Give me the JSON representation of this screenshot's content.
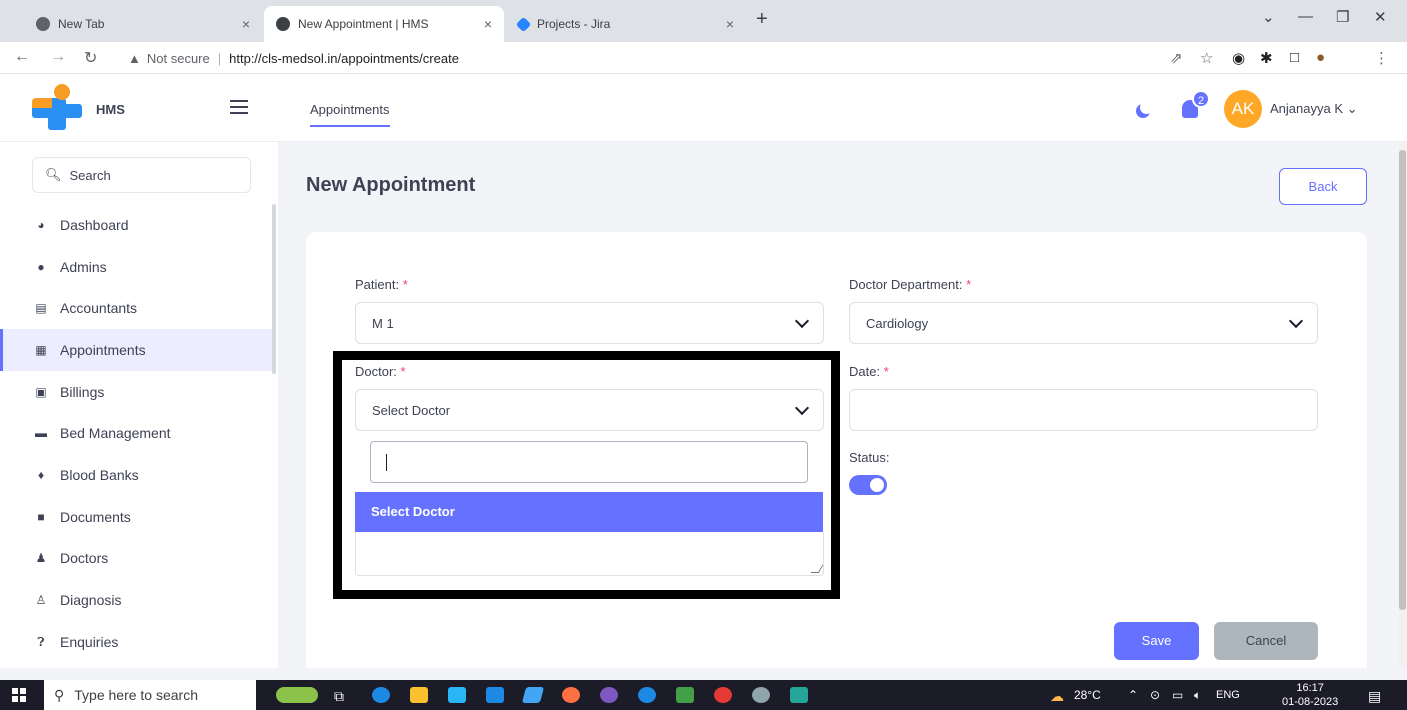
{
  "browser": {
    "tabs": [
      {
        "title": "New Tab",
        "active": false
      },
      {
        "title": "New Appointment | HMS",
        "active": true
      },
      {
        "title": "Projects - Jira",
        "active": false
      }
    ],
    "close_glyph": "×",
    "new_tab_glyph": "+",
    "security_label": "Not secure",
    "url": "http://cls-medsol.in/appointments/create"
  },
  "header": {
    "app_name": "HMS",
    "nav_item": "Appointments",
    "notification_count": "2",
    "avatar_initials": "AK",
    "user_name": "Anjanayya K",
    "user_caret": "⌄"
  },
  "sidebar": {
    "search_placeholder": "Search",
    "items": [
      {
        "label": "Dashboard",
        "icon": "pie-chart-icon"
      },
      {
        "label": "Admins",
        "icon": "user-icon"
      },
      {
        "label": "Accountants",
        "icon": "file-icon"
      },
      {
        "label": "Appointments",
        "icon": "calendar-icon"
      },
      {
        "label": "Billings",
        "icon": "receipt-icon"
      },
      {
        "label": "Bed Management",
        "icon": "bed-icon"
      },
      {
        "label": "Blood Banks",
        "icon": "drop-icon"
      },
      {
        "label": "Documents",
        "icon": "document-icon"
      },
      {
        "label": "Doctors",
        "icon": "doctor-icon"
      },
      {
        "label": "Diagnosis",
        "icon": "diagnosis-icon"
      },
      {
        "label": "Enquiries",
        "icon": "question-icon"
      }
    ]
  },
  "page": {
    "title": "New Appointment",
    "back_label": "Back"
  },
  "form": {
    "patient_label": "Patient:",
    "patient_value": "M 1",
    "department_label": "Doctor Department:",
    "department_value": "Cardiology",
    "doctor_label": "Doctor:",
    "doctor_placeholder": "Select Doctor",
    "doctor_option": "Select Doctor",
    "date_label": "Date:",
    "status_label": "Status:",
    "status_on": true,
    "required_mark": "*",
    "save_label": "Save",
    "cancel_label": "Cancel"
  },
  "taskbar": {
    "search_placeholder": "Type here to search",
    "weather": "28°C",
    "language": "ENG",
    "time": "16:17",
    "date": "01-08-2023"
  },
  "colors": {
    "primary": "#6571ff",
    "avatar": "#ffa726",
    "required": "#f1416c",
    "logo_blue": "#2a8ff2",
    "logo_orange": "#f79d24"
  }
}
